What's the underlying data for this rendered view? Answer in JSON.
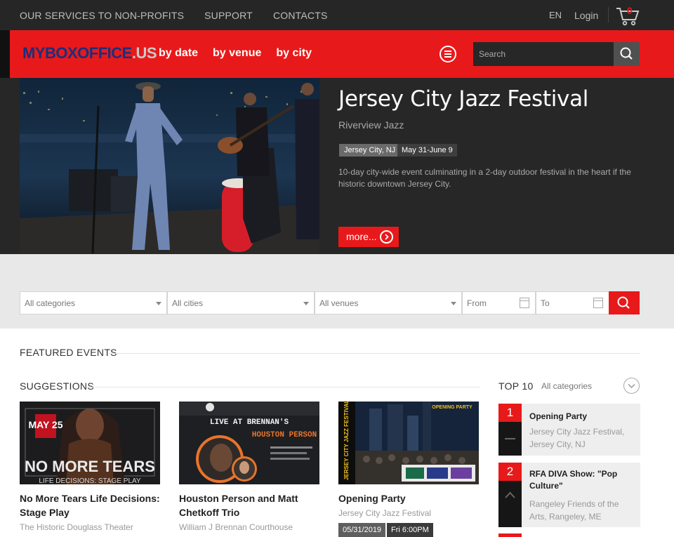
{
  "topbar": {
    "nav": [
      "OUR SERVICES TO NON-PROFITS",
      "SUPPORT",
      "CONTACTS"
    ],
    "lang": "EN",
    "login": "Login",
    "cart_count": "0"
  },
  "header": {
    "logo_main": "MYBOXOFFICE",
    "logo_us": ".US",
    "nav": [
      "by date",
      "by venue",
      "by city"
    ],
    "search_placeholder": "Search"
  },
  "hero": {
    "title": "Jersey City Jazz Festival",
    "subtitle": "Riverview Jazz",
    "location": "Jersey City, NJ",
    "dates": "May 31-June 9",
    "description": "10-day city-wide event culminating in a 2-day outdoor festival in the heart if the historic downtown Jersey City.",
    "more_label": "more..."
  },
  "filters": {
    "categories": "All categories",
    "cities": "All cities",
    "venues": "All venues",
    "from": "From",
    "to": "To"
  },
  "featured_heading": "FEATURED EVENTS",
  "suggestions": {
    "heading": "SUGGESTIONS",
    "cards": [
      {
        "title": "No More Tears Life Decisions: Stage Play",
        "venue": "The Historic Douglass Theater",
        "poster_text": "NO MORE TEARS",
        "poster_sub": "LIFE DECISIONS: STAGE PLAY",
        "poster_date": "MAY 25"
      },
      {
        "title": "Houston Person and Matt Chetkoff Trio",
        "venue": "William J Brennan Courthouse",
        "poster_text": "LIVE AT BRENNAN'S",
        "poster_sub": "HOUSTON PERSON"
      },
      {
        "title": "Opening Party",
        "venue": "Jersey City Jazz Festival",
        "date": "05/31/2019",
        "time": "Fri 6:00PM",
        "poster_text": "JERSEY CITY JAZZ FESTIVAL",
        "poster_sub": "OPENING PARTY"
      }
    ]
  },
  "top10": {
    "heading": "TOP 10",
    "category": "All categories",
    "items": [
      {
        "rank": "1",
        "title": "Opening Party",
        "sub": "Jersey City Jazz Festival, Jersey City, NJ"
      },
      {
        "rank": "2",
        "title": "RFA DIVA Show: \"Pop Culture\"",
        "sub": "Rangeley Friends of the Arts, Rangeley, ME"
      }
    ]
  },
  "colors": {
    "brand_red": "#e8191a",
    "dark": "#272727",
    "topbar": "#262626"
  }
}
